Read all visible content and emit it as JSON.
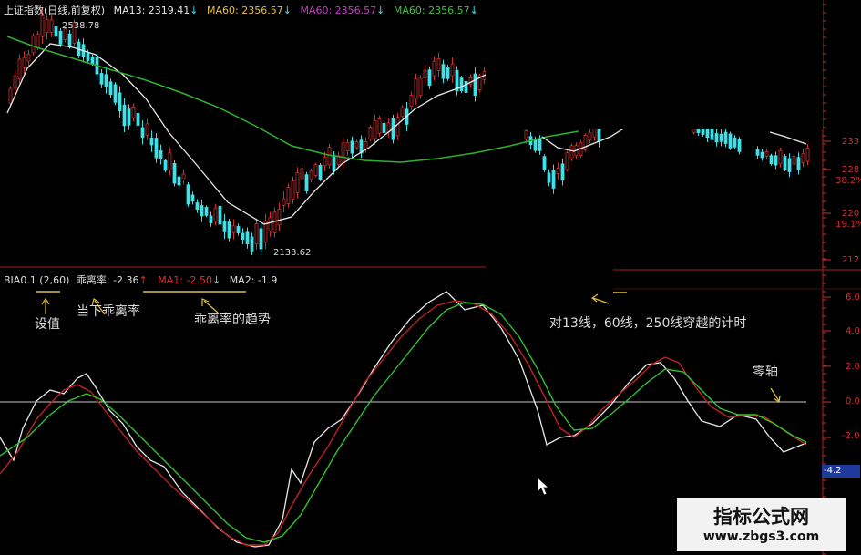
{
  "header": {
    "title": "上证指数(日线,前复权)",
    "ma13": "MA13: 2319.41",
    "ma60a": "MA60: 2356.57",
    "ma60b": "MA60: 2356.57",
    "ma60c": "MA60: 2356.57",
    "down_arrow": "↓",
    "high_label": "2538.78",
    "low_label": "2133.62"
  },
  "bias_header": {
    "name": "BIA0.1 (2,60)",
    "bias": "乖离率: -2.36",
    "ma1": "MA1: -2.50",
    "ma2": "MA2: -1.9",
    "up_arrow": "↑",
    "down_arrow": "↓"
  },
  "annotations": {
    "setting": "设值",
    "current_bias": "当下乖离率",
    "bias_trend": "乖离率的趋势",
    "cross_timing": "对13线，60线，250线穿越的计时",
    "zero_axis": "零轴"
  },
  "right_axis": {
    "price_labels": [
      "233",
      "228",
      "38.2%",
      "220",
      "19.1%",
      "212"
    ],
    "bias_labels": [
      "6.0",
      "4.0",
      "2.0",
      "0.0",
      "-2.0",
      "-4.2"
    ],
    "current_value": "-4.2"
  },
  "watermark": {
    "name": "指标公式网",
    "url": "www.zbgs3.com"
  },
  "colors": {
    "up": "#d03030",
    "down": "#40e0e8",
    "ma13": "#e8e8e8",
    "ma60": "#30b030",
    "bias": "#e8e8e8",
    "ma1": "#c02020",
    "ma2": "#30c030",
    "axis": "#d03030",
    "ma60_label_1": "#e0c040",
    "ma60_label_2": "#c040c0",
    "ma60_label_3": "#40c040"
  }
}
